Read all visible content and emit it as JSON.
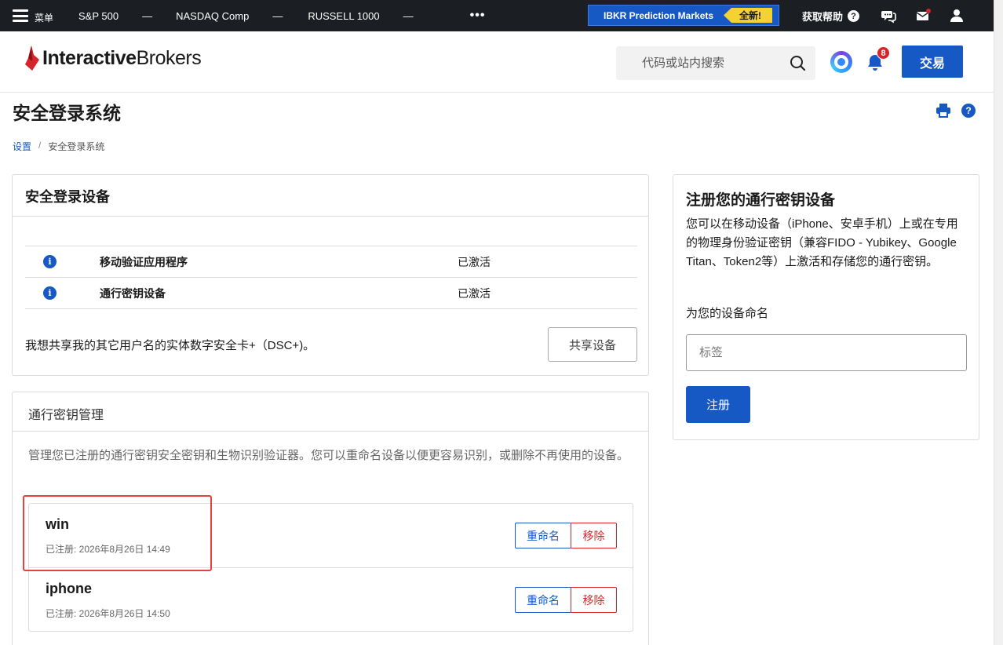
{
  "topbar": {
    "menu_label": "菜单",
    "tickers": [
      {
        "name": "S&P 500",
        "value": "—"
      },
      {
        "name": "NASDAQ Comp",
        "value": "—"
      },
      {
        "name": "RUSSELL 1000",
        "value": "—"
      }
    ],
    "more": "•••",
    "prediction_label": "IBKR Prediction Markets",
    "new_badge": "全新!",
    "help_label": "获取帮助",
    "help_q": "?"
  },
  "header": {
    "logo_bold": "Interactive",
    "logo_regular": "Brokers",
    "search_placeholder": "代码或站内搜索",
    "notification_count": "8",
    "trade_label": "交易"
  },
  "page": {
    "title": "安全登录系统",
    "help_q": "?",
    "breadcrumb": [
      "设置",
      "/",
      "安全登录系统"
    ]
  },
  "secure_devices": {
    "title": "安全登录设备",
    "rows": [
      {
        "name": "移动验证应用程序",
        "status": "已激活"
      },
      {
        "name": "通行密钥设备",
        "status": "已激活"
      }
    ],
    "share_text": "我想共享我的其它用户名的实体数字安全卡+（DSC+)。",
    "share_button": "共享设备"
  },
  "passkey_mgmt": {
    "title": "通行密钥管理",
    "description": "管理您已注册的通行密钥安全密钥和生物识别验证器。您可以重命名设备以便更容易识别，或删除不再使用的设备。",
    "devices": [
      {
        "name": "win",
        "registered": "已注册: 2026年8月26日 14:49",
        "rename": "重命名",
        "remove": "移除"
      },
      {
        "name": "iphone",
        "registered": "已注册: 2026年8月26日 14:50",
        "rename": "重命名",
        "remove": "移除"
      }
    ]
  },
  "register_panel": {
    "title": "注册您的通行密钥设备",
    "body": "您可以在移动设备（iPhone、安卓手机）上或在专用的物理身份验证密钥（兼容FIDO - Yubikey、Google Titan、Token2等）上激活和存储您的通行密钥。",
    "name_label": "为您的设备命名",
    "input_placeholder": "标签",
    "register_button": "注册"
  },
  "colors": {
    "brand_blue": "#1658c4",
    "topbar_bg": "#1b1f24",
    "danger_red": "#d6242a",
    "badge_yellow": "#f5d233",
    "highlight": "#e4433b"
  },
  "icons": {
    "menu": "hamburger-icon",
    "search": "search-icon",
    "bell": "bell-icon",
    "print": "print-icon",
    "info": "info-icon",
    "chat": "chat-icon",
    "mail": "mail-icon",
    "user": "user-icon"
  }
}
